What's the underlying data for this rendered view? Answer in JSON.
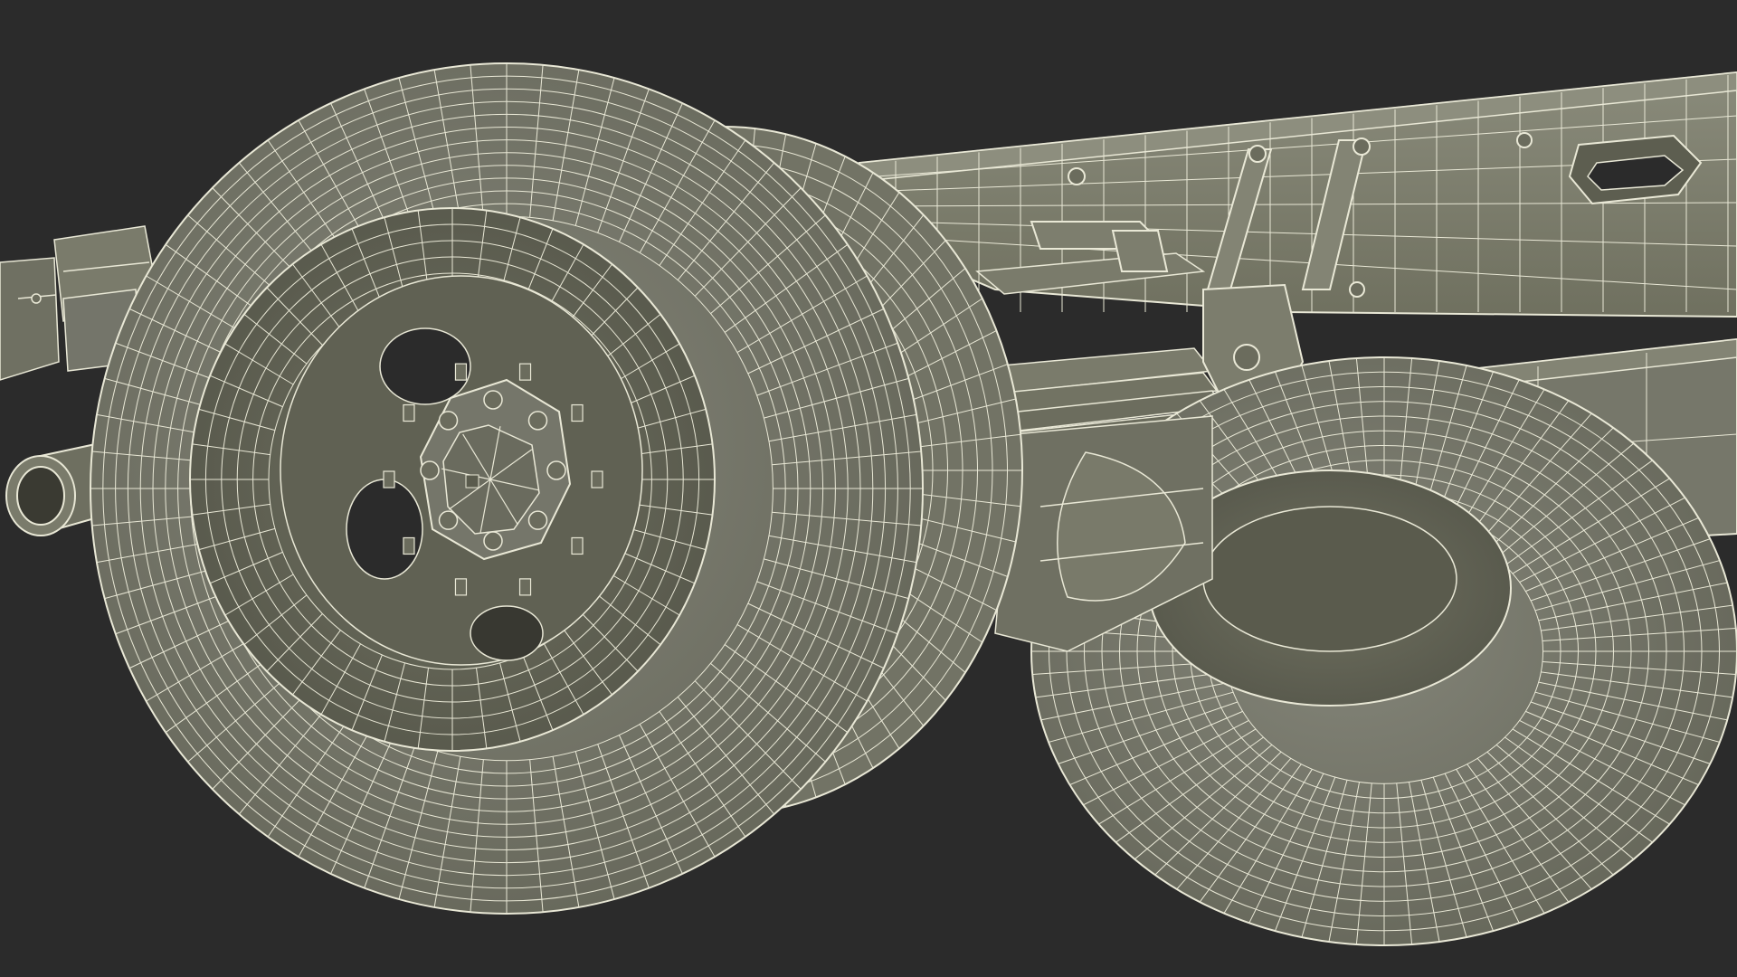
{
  "scene": {
    "subject": "truck-rear-axle-wireframe-render",
    "colors": {
      "background": "#2b2b2b",
      "tire_fill": "#797a69",
      "tire_shadow": "#62634f",
      "wheel_fill": "#6e6f5f",
      "wheel_dark": "#4d4e40",
      "frame_fill": "#7e7f6e",
      "frame_dark": "#6a6b5b",
      "wire": "#e9e8d6",
      "wire_dim": "#d8d7c2"
    },
    "meshes": [
      "chassis-frame-rail",
      "leaf-spring-assembly",
      "axle-beam",
      "front-outer-tire",
      "front-inner-tire",
      "front-wheel-rim",
      "front-wheel-hub",
      "rear-outer-tire",
      "rear-wheel-rim",
      "spring-hanger-brackets",
      "exhaust-pipe",
      "left-frame-stub"
    ]
  }
}
